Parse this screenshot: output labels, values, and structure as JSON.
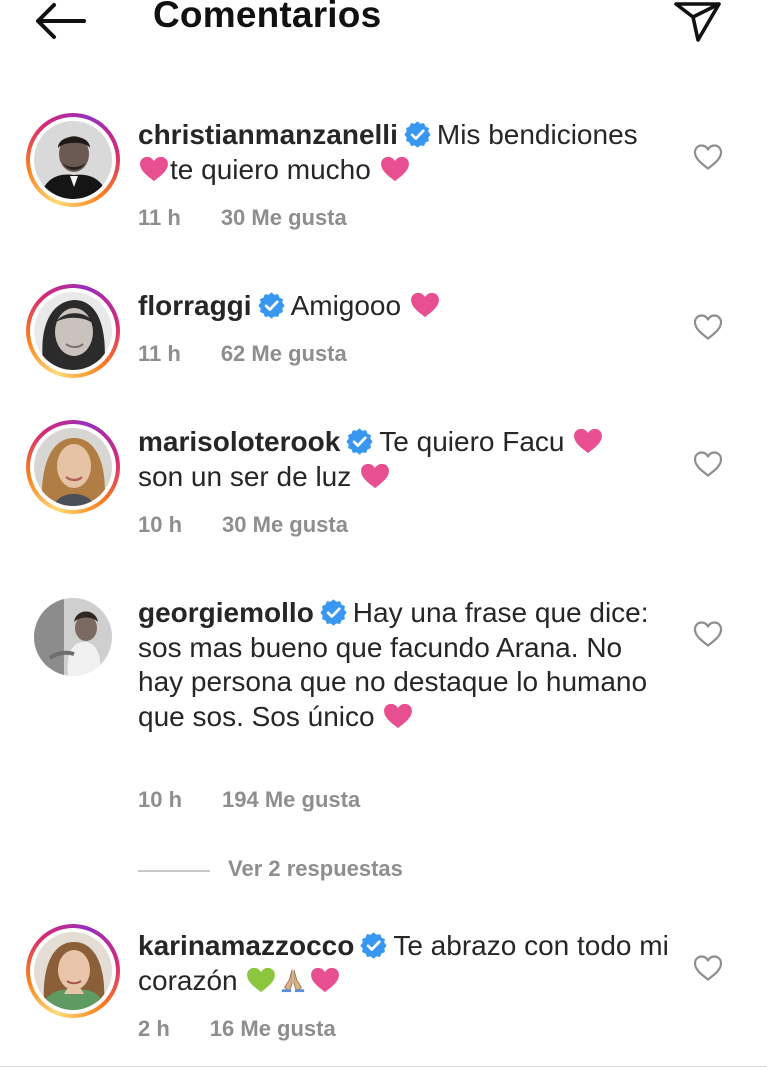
{
  "header": {
    "title": "Comentarios"
  },
  "comments": [
    {
      "username": "christianmanzanelli",
      "text_before": "Mis bendiciones",
      "text_after": "te quiero mucho",
      "time": "11 h",
      "likes": "30 Me gusta"
    },
    {
      "username": "florraggi",
      "text": "Amigooo",
      "time": "11 h",
      "likes": "62 Me gusta"
    },
    {
      "username": "marisoloterook",
      "text": "Te quiero Facu",
      "text2": "son un ser de luz",
      "time": "10 h",
      "likes": "30 Me gusta"
    },
    {
      "username": "georgiemollo",
      "text": "Hay una frase que dice: sos mas bueno que facundo Arana. No hay persona que no destaque lo humano que sos. Sos único",
      "time": "10 h",
      "likes": "194 Me gusta",
      "replies_label": "Ver 2 respuestas"
    },
    {
      "username": "karinamazzocco",
      "text": "Te abrazo con todo mi corazón",
      "time": "2 h",
      "likes": "16 Me gusta"
    }
  ],
  "colors": {
    "verified": "#3897f0",
    "heart": "#e84f91",
    "muted": "#8e8e8e",
    "green_heart": "#8cc63f"
  },
  "icons": [
    "back-arrow-icon",
    "send-icon",
    "verified-badge-icon",
    "pink-heart-emoji",
    "green-heart-emoji",
    "praying-hands-emoji",
    "like-heart-icon"
  ]
}
